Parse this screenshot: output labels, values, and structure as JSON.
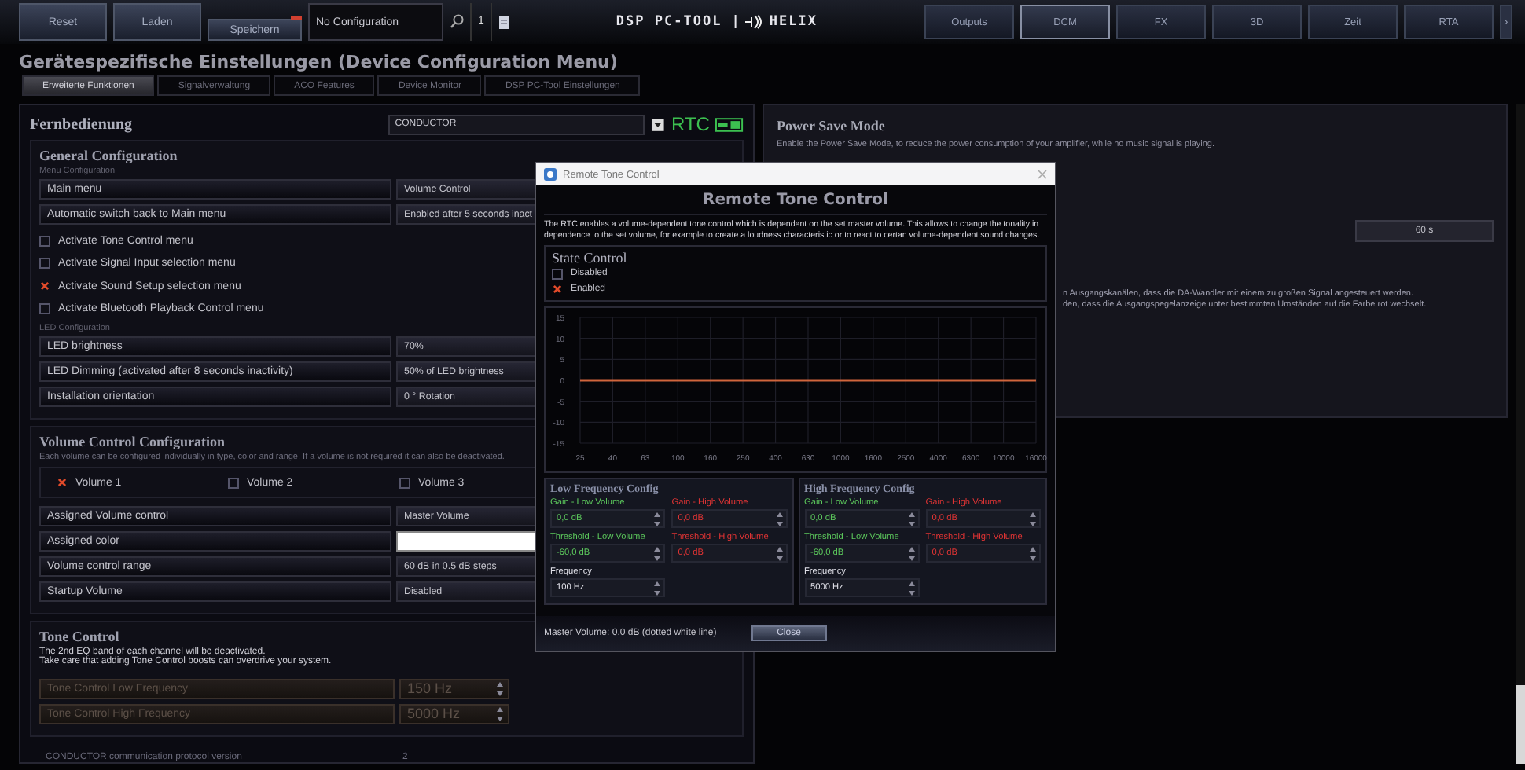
{
  "toolbar": {
    "buttons": [
      {
        "label": "Reset",
        "modified": false
      },
      {
        "label": "Laden",
        "modified": false
      },
      {
        "label": "Speichern",
        "modified": true
      }
    ],
    "config_field": {
      "value": "No Configuration"
    },
    "count": "1",
    "logo": {
      "left": "DSP PC-TOOL |",
      "right": "HELIX"
    },
    "nav": [
      {
        "label": "Outputs",
        "selected": false
      },
      {
        "label": "DCM",
        "selected": true
      },
      {
        "label": "FX",
        "selected": false
      },
      {
        "label": "3D",
        "selected": false
      },
      {
        "label": "Zeit",
        "selected": false
      },
      {
        "label": "RTA",
        "selected": false
      }
    ],
    "nav_more": "›"
  },
  "page_title": "Gerätespezifische Einstellungen (Device Configuration Menu)",
  "tabs": [
    {
      "label": "Erweiterte Funktionen",
      "selected": true
    },
    {
      "label": "Signalverwaltung",
      "selected": false
    },
    {
      "label": "ACO Features",
      "selected": false
    },
    {
      "label": "Device Monitor",
      "selected": false
    },
    {
      "label": "DSP PC-Tool Einstellungen",
      "selected": false
    }
  ],
  "remote": {
    "title": "Fernbedienung",
    "device": "CONDUCTOR",
    "rtc_label": "RTC",
    "general": {
      "title": "General Configuration",
      "menu_label": "Menu Configuration",
      "rows": [
        {
          "label": "Main menu",
          "value": "Volume Control"
        },
        {
          "label": "Automatic switch back to Main menu",
          "value": "Enabled after 5 seconds inact"
        }
      ],
      "options": [
        {
          "label": "Activate Tone Control menu",
          "checked": false
        },
        {
          "label": "Activate Signal Input selection menu",
          "checked": false
        },
        {
          "label": "Activate Sound Setup selection menu",
          "checked": true
        },
        {
          "label": "Activate Bluetooth Playback Control menu",
          "checked": false
        }
      ],
      "led_label": "LED Configuration",
      "led_rows": [
        {
          "label": "LED brightness",
          "value": "70%"
        },
        {
          "label": "LED Dimming (activated after 8 seconds inactivity)",
          "value": "50% of LED brightness"
        },
        {
          "label": "Installation orientation",
          "value": "0 ° Rotation"
        }
      ]
    },
    "volume": {
      "title": "Volume Control Configuration",
      "description": "Each volume can be configured individually in type, color and range. If a volume is not required it can also be deactivated.",
      "volumes": [
        {
          "label": "Volume 1",
          "checked": true
        },
        {
          "label": "Volume 2",
          "checked": false
        },
        {
          "label": "Volume 3",
          "checked": false
        }
      ],
      "rows": [
        {
          "kind": "text",
          "label": "Assigned Volume control",
          "value": "Master Volume"
        },
        {
          "kind": "swatch",
          "label": "Assigned color",
          "color": "#ffffff"
        },
        {
          "kind": "text",
          "label": "Volume control range",
          "value": "60 dB in 0.5 dB steps"
        },
        {
          "kind": "text",
          "label": "Startup Volume",
          "value": "Disabled"
        }
      ]
    },
    "tone": {
      "title": "Tone Control",
      "notes": [
        "The 2nd EQ band of each channel will be deactivated.",
        "Take care that adding Tone Control boosts can overdrive your system."
      ],
      "rows": [
        {
          "label": "Tone Control Low Frequency",
          "value": "150 Hz",
          "disabled": true
        },
        {
          "label": "Tone Control High Frequency",
          "value": "5000 Hz",
          "disabled": true
        }
      ]
    },
    "protocol": {
      "label": "CONDUCTOR communication protocol version",
      "value": "2"
    }
  },
  "power_save": {
    "title": "Power Save Mode",
    "description": "Enable the Power Save Mode, to reduce the power consumption of your amplifier, while no music signal is playing.",
    "timeout": "60 s",
    "notes": [
      "n Ausgangskanälen, dass die DA-Wandler mit einem zu großen Signal angesteuert werden.",
      "den, dass die Ausgangspegelanzeige unter bestimmten Umständen auf die Farbe rot wechselt."
    ]
  },
  "dialog": {
    "window_title": "Remote Tone Control",
    "heading": "Remote Tone Control",
    "description": "The RTC enables a volume-dependent tone control which is dependent on the set master volume. This allows to change the tonality in dependence to the set volume, for example to create a loudness characteristic or to react to certan volume-dependent sound changes.",
    "state": {
      "title": "State Control",
      "options": [
        {
          "label": "Disabled",
          "selected": false
        },
        {
          "label": "Enabled",
          "selected": true
        }
      ]
    },
    "chart_data": {
      "type": "line",
      "categories": [
        "25",
        "40",
        "63",
        "100",
        "160",
        "250",
        "400",
        "630",
        "1000",
        "1600",
        "2500",
        "4000",
        "6300",
        "10000",
        "16000"
      ],
      "series": [
        {
          "color": "#d0653c",
          "values": [
            0,
            0,
            0,
            0,
            0,
            0,
            0,
            0,
            0,
            0,
            0,
            0,
            0,
            0,
            0
          ]
        }
      ],
      "ylim": [
        -15,
        15
      ],
      "grid": true,
      "yticks": [
        -15,
        -10,
        -5,
        0,
        5,
        10,
        15
      ]
    },
    "bands": [
      {
        "title": "Low Frequency Config",
        "params": [
          {
            "label": "Gain - Low Volume",
            "value": "0,0 dB",
            "color": "#5cc85c"
          },
          {
            "label": "Gain - High Volume",
            "value": "0,0 dB",
            "color": "#e03434"
          },
          {
            "label": "Threshold - Low Volume",
            "value": "-60,0 dB",
            "color": "#5cc85c"
          },
          {
            "label": "Threshold - High Volume",
            "value": "0,0 dB",
            "color": "#e03434"
          }
        ],
        "frequency": {
          "label": "Frequency",
          "value": "100 Hz"
        }
      },
      {
        "title": "High Frequency Config",
        "params": [
          {
            "label": "Gain - Low Volume",
            "value": "0,0 dB",
            "color": "#5cc85c"
          },
          {
            "label": "Gain - High Volume",
            "value": "0,0 dB",
            "color": "#e03434"
          },
          {
            "label": "Threshold - Low Volume",
            "value": "-60,0 dB",
            "color": "#5cc85c"
          },
          {
            "label": "Threshold - High Volume",
            "value": "0,0 dB",
            "color": "#e03434"
          }
        ],
        "frequency": {
          "label": "Frequency",
          "value": "5000 Hz"
        }
      }
    ],
    "footer": "Master Volume: 0.0 dB (dotted white line)",
    "close": "Close"
  }
}
